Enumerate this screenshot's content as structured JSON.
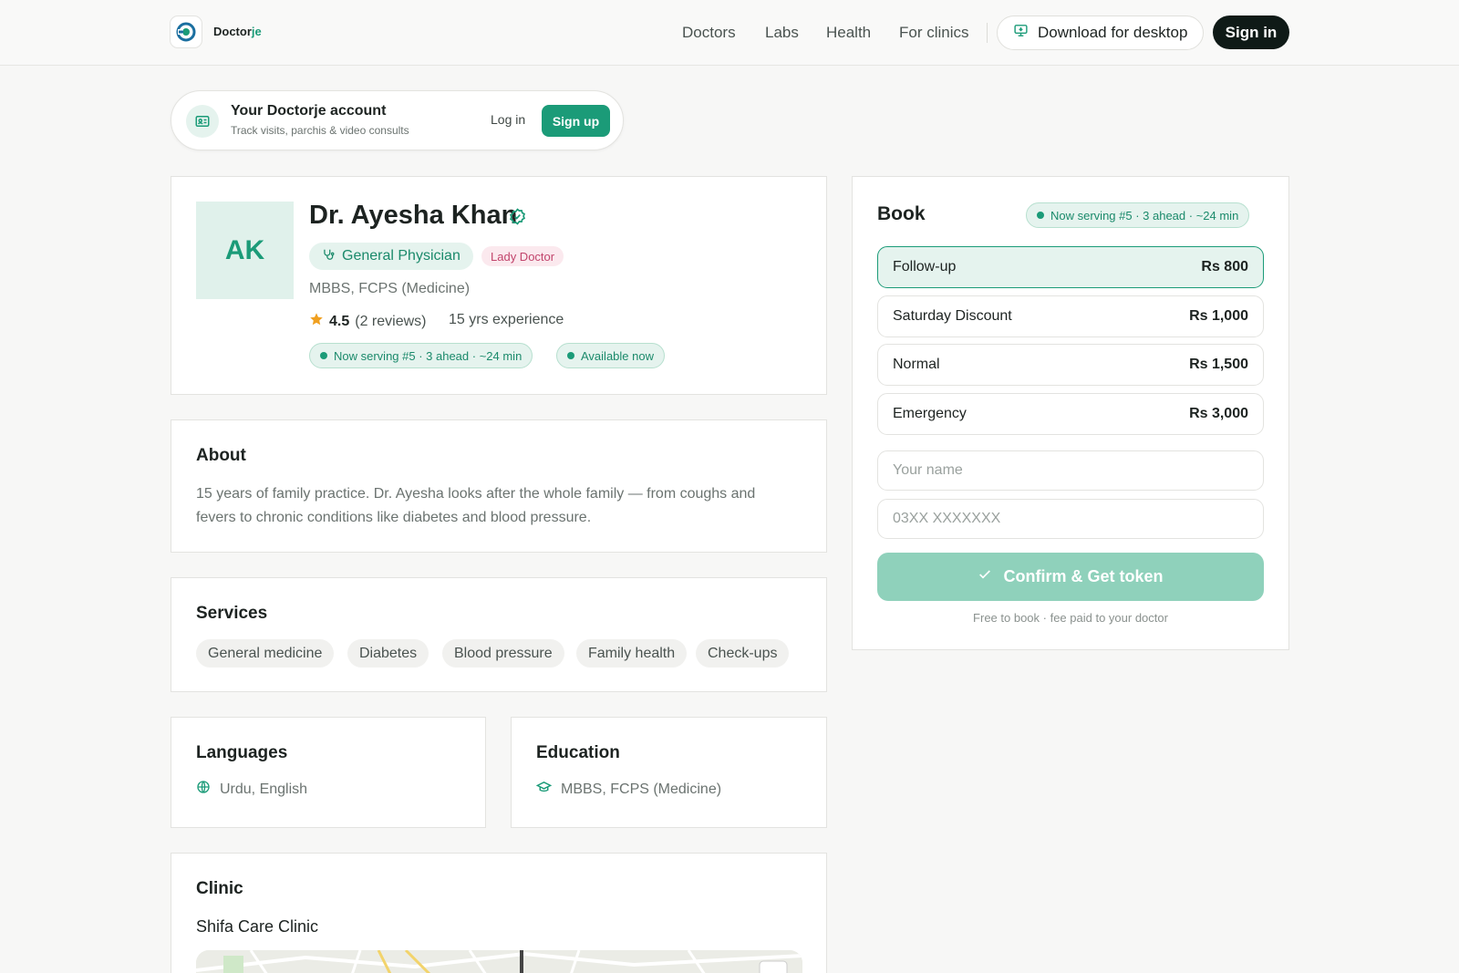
{
  "header": {
    "brand": {
      "part1": "Doctor",
      "part2": "je"
    },
    "nav": [
      "Doctors",
      "Labs",
      "Health",
      "For clinics"
    ],
    "download_label": "Download for desktop",
    "signin_label": "Sign in"
  },
  "account": {
    "title": "Your Doctorje account",
    "subtitle": "Track visits, parchis & video consults",
    "login": "Log in",
    "signup": "Sign up"
  },
  "doctor": {
    "initials": "AK",
    "name": "Dr. Ayesha Khan",
    "specialty": "General Physician",
    "tag": "Lady Doctor",
    "qualifications": "MBBS, FCPS (Medicine)",
    "rating": "4.5",
    "reviews": "(2 reviews)",
    "experience": "15 yrs experience",
    "now_serving": "Now serving #5 · 3 ahead · ~24 min",
    "availability": "Available now"
  },
  "about": {
    "title": "About",
    "text": "15 years of family practice. Dr. Ayesha looks after the whole family — from coughs and fevers to chronic conditions like diabetes and blood pressure."
  },
  "services": {
    "title": "Services",
    "items": [
      "General medicine",
      "Diabetes",
      "Blood pressure",
      "Family health",
      "Check-ups"
    ]
  },
  "languages": {
    "title": "Languages",
    "value": "Urdu, English"
  },
  "education": {
    "title": "Education",
    "value": "MBBS, FCPS (Medicine)"
  },
  "clinic": {
    "title": "Clinic",
    "name": "Shifa Care Clinic"
  },
  "booking": {
    "title": "Book",
    "status": "Now serving #5 · 3 ahead · ~24 min",
    "fees": [
      {
        "label": "Follow-up",
        "price": "Rs 800",
        "selected": true
      },
      {
        "label": "Saturday Discount",
        "price": "Rs 1,000",
        "selected": false
      },
      {
        "label": "Normal",
        "price": "Rs 1,500",
        "selected": false
      },
      {
        "label": "Emergency",
        "price": "Rs 3,000",
        "selected": false
      }
    ],
    "name_placeholder": "Your name",
    "phone_placeholder": "03XX XXXXXXX",
    "confirm_label": "Confirm & Get token",
    "note": "Free to book · fee paid to your doctor"
  },
  "colors": {
    "accent": "#1b9b78",
    "accent_light": "#e5f3ee",
    "dark_button": "#0f1a17",
    "lady_tag": "#c2456c",
    "star": "#f0a020"
  }
}
